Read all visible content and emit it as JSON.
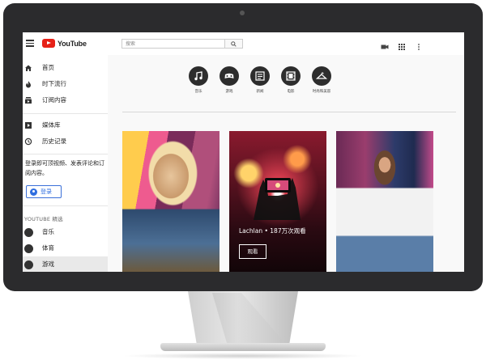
{
  "header": {
    "logo_text": "YouTube",
    "search_placeholder": "搜索",
    "dropdown_hint": "^"
  },
  "sidebar": {
    "nav": [
      {
        "label": "首页",
        "icon": "home-icon"
      },
      {
        "label": "时下流行",
        "icon": "flame-icon"
      },
      {
        "label": "订阅内容",
        "icon": "subscriptions-icon"
      }
    ],
    "library": [
      {
        "label": "媒体库",
        "icon": "library-icon"
      },
      {
        "label": "历史记录",
        "icon": "history-icon"
      }
    ],
    "signin_text": "登录即可顶视频、发表评论和订阅内容。",
    "signin_button": "登录",
    "section_title": "YOUTUBE 精选",
    "featured": [
      {
        "label": "音乐",
        "icon": "music-icon"
      },
      {
        "label": "体育",
        "icon": "sports-icon"
      },
      {
        "label": "游戏",
        "icon": "gaming-icon",
        "active": true
      }
    ]
  },
  "categories": [
    {
      "label": "音乐",
      "icon": "music-note-icon"
    },
    {
      "label": "游戏",
      "icon": "gamepad-icon"
    },
    {
      "label": "新闻",
      "icon": "news-icon"
    },
    {
      "label": "电影",
      "icon": "film-icon"
    },
    {
      "label": "时尚和美容",
      "icon": "hanger-icon"
    }
  ],
  "cards": [
    {
      "caption": "",
      "button": ""
    },
    {
      "caption": "Lachlan • 187万次观看",
      "button": "观看"
    },
    {
      "caption": "",
      "button": ""
    }
  ],
  "colors": {
    "youtube_red": "#e62117",
    "signin_blue": "#2f6ee0",
    "bezel": "#2b2b2d",
    "screen_accent": "#4a3a8a"
  }
}
